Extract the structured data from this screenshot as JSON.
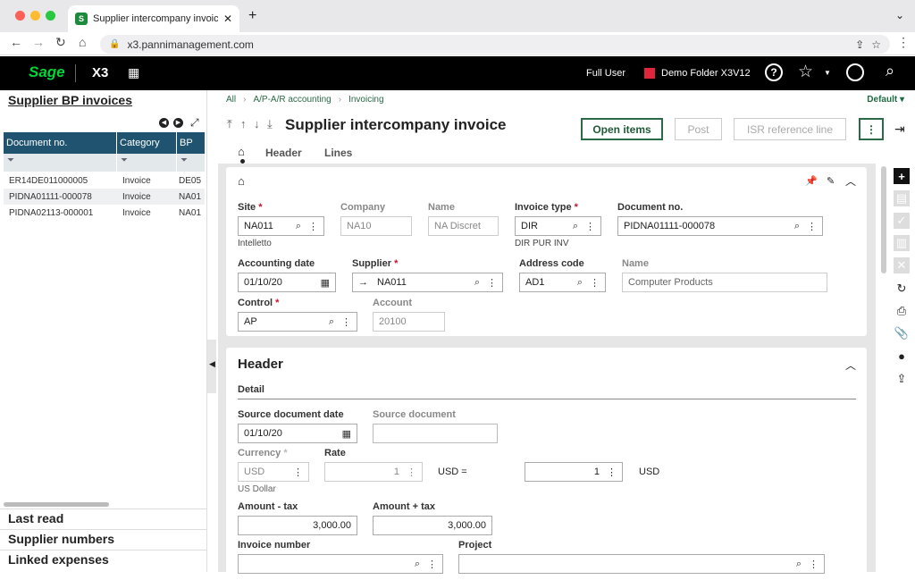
{
  "browser": {
    "tab_title": "Supplier intercompany invoice",
    "tab_favicon": "S",
    "url": "x3.pannimanagement.com"
  },
  "topbar": {
    "logo": "Sage",
    "product": "X3",
    "user": "Full User",
    "folder": "Demo Folder X3V12",
    "folder_color": "#e0263c"
  },
  "left_panel": {
    "title": "Supplier BP invoices",
    "columns": [
      "Document no.",
      "Category",
      "BP"
    ],
    "rows": [
      {
        "doc": "ER14DE011000005",
        "category": "Invoice",
        "bp": "DE05"
      },
      {
        "doc": "PIDNA01111-000078",
        "category": "Invoice",
        "bp": "NA01"
      },
      {
        "doc": "PIDNA02113-000001",
        "category": "Invoice",
        "bp": "NA01"
      }
    ],
    "sections": [
      "Last read",
      "Supplier numbers",
      "Linked expenses"
    ]
  },
  "breadcrumb": {
    "items": [
      "All",
      "A/P-A/R accounting",
      "Invoicing"
    ],
    "view": "Default"
  },
  "page": {
    "title": "Supplier intercompany invoice",
    "buttons": {
      "open_items": "Open items",
      "post": "Post",
      "isr": "ISR reference line"
    },
    "tabs": [
      "Header",
      "Lines"
    ]
  },
  "form": {
    "site": {
      "label": "Site",
      "value": "NA011",
      "sub": "Intelletto"
    },
    "company": {
      "label": "Company",
      "value": "NA10"
    },
    "name1": {
      "label": "Name",
      "value": "NA Discret"
    },
    "invoice_type": {
      "label": "Invoice type",
      "value": "DIR",
      "sub": "DIR PUR INV"
    },
    "document_no": {
      "label": "Document no.",
      "value": "PIDNA01111-000078"
    },
    "accounting_date": {
      "label": "Accounting date",
      "value": "01/10/20"
    },
    "supplier": {
      "label": "Supplier",
      "value": "NA011"
    },
    "address_code": {
      "label": "Address code",
      "value": "AD1"
    },
    "name2": {
      "label": "Name",
      "value": "Computer Products"
    },
    "control": {
      "label": "Control",
      "value": "AP"
    },
    "account": {
      "label": "Account",
      "value": "20100"
    }
  },
  "header_section": {
    "title": "Header",
    "subtitle": "Detail",
    "source_date": {
      "label": "Source document date",
      "value": "01/10/20"
    },
    "source_doc": {
      "label": "Source document",
      "value": ""
    },
    "currency": {
      "label": "Currency",
      "value": "USD",
      "sub": "US Dollar"
    },
    "rate": {
      "label": "Rate",
      "value": "1"
    },
    "rate_eq": "USD =",
    "rate2": {
      "value": "1"
    },
    "rate_cur": "USD",
    "amount_tax_ex": {
      "label": "Amount - tax",
      "value": "3,000.00"
    },
    "amount_tax_in": {
      "label": "Amount + tax",
      "value": "3,000.00"
    },
    "invoice_number": {
      "label": "Invoice number",
      "value": ""
    },
    "project": {
      "label": "Project",
      "value": ""
    }
  }
}
